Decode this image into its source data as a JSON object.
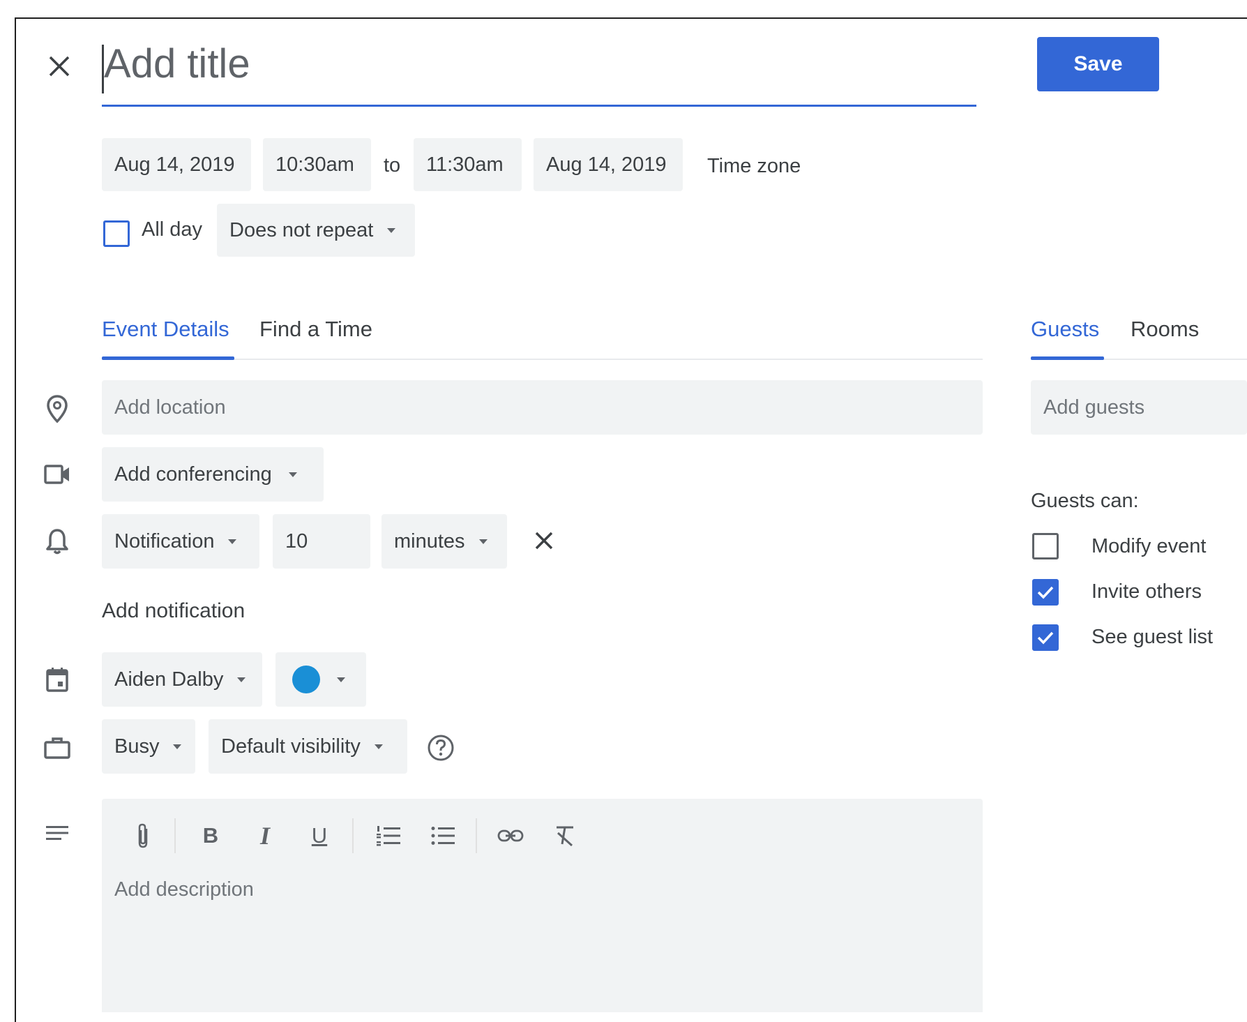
{
  "header": {
    "close_icon": "close-icon",
    "title_placeholder": "Add title",
    "save_label": "Save",
    "accent_color": "#3367d6"
  },
  "datetime": {
    "start_date": "Aug 14, 2019",
    "start_time": "10:30am",
    "to_label": "to",
    "end_time": "11:30am",
    "end_date": "Aug 14, 2019",
    "timezone_label": "Time zone",
    "all_day_label": "All day",
    "all_day_checked": false,
    "repeat_value": "Does not repeat"
  },
  "tabs": {
    "event_details": "Event Details",
    "find_a_time": "Find a Time",
    "active": "Event Details"
  },
  "details": {
    "location_placeholder": "Add location",
    "conferencing_label": "Add conferencing",
    "notification_type": "Notification",
    "notification_amount": "10",
    "notification_unit": "minutes",
    "add_notification": "Add notification",
    "calendar_owner": "Aiden Dalby",
    "calendar_color": "#1a8fd6",
    "availability": "Busy",
    "visibility": "Default visibility",
    "description_placeholder": "Add description"
  },
  "toolbar": {
    "icons": [
      "attachment-icon",
      "bold-icon",
      "italic-icon",
      "underline-icon",
      "numbered-list-icon",
      "bulleted-list-icon",
      "link-icon",
      "clear-formatting-icon"
    ]
  },
  "guests_panel": {
    "tab_guests": "Guests",
    "tab_rooms": "Rooms",
    "active": "Guests",
    "add_guests_placeholder": "Add guests",
    "guests_can_label": "Guests can:",
    "permissions": [
      {
        "label": "Modify event",
        "checked": false
      },
      {
        "label": "Invite others",
        "checked": true
      },
      {
        "label": "See guest list",
        "checked": true
      }
    ]
  }
}
